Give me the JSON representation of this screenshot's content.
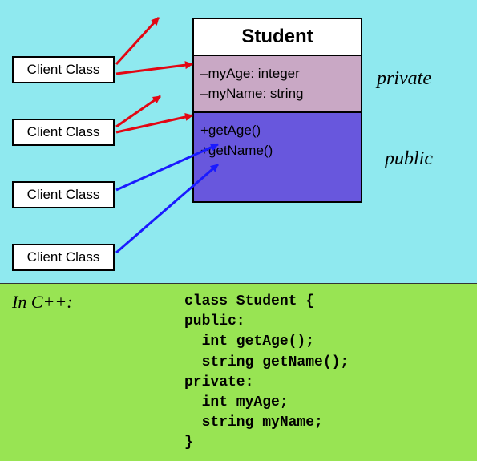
{
  "clients": {
    "c1": "Client Class",
    "c2": "Client Class",
    "c3": "Client Class",
    "c4": "Client Class"
  },
  "uml": {
    "title": "Student",
    "attr1": "–myAge: integer",
    "attr2": "–myName: string",
    "op1": "+getAge()",
    "op2": "+getName()"
  },
  "labels": {
    "private": "private",
    "public": "public",
    "language": "In C++:"
  },
  "code": "class Student {\npublic:\n  int getAge();\n  string getName();\nprivate:\n  int myAge;\n  string myName;\n}"
}
